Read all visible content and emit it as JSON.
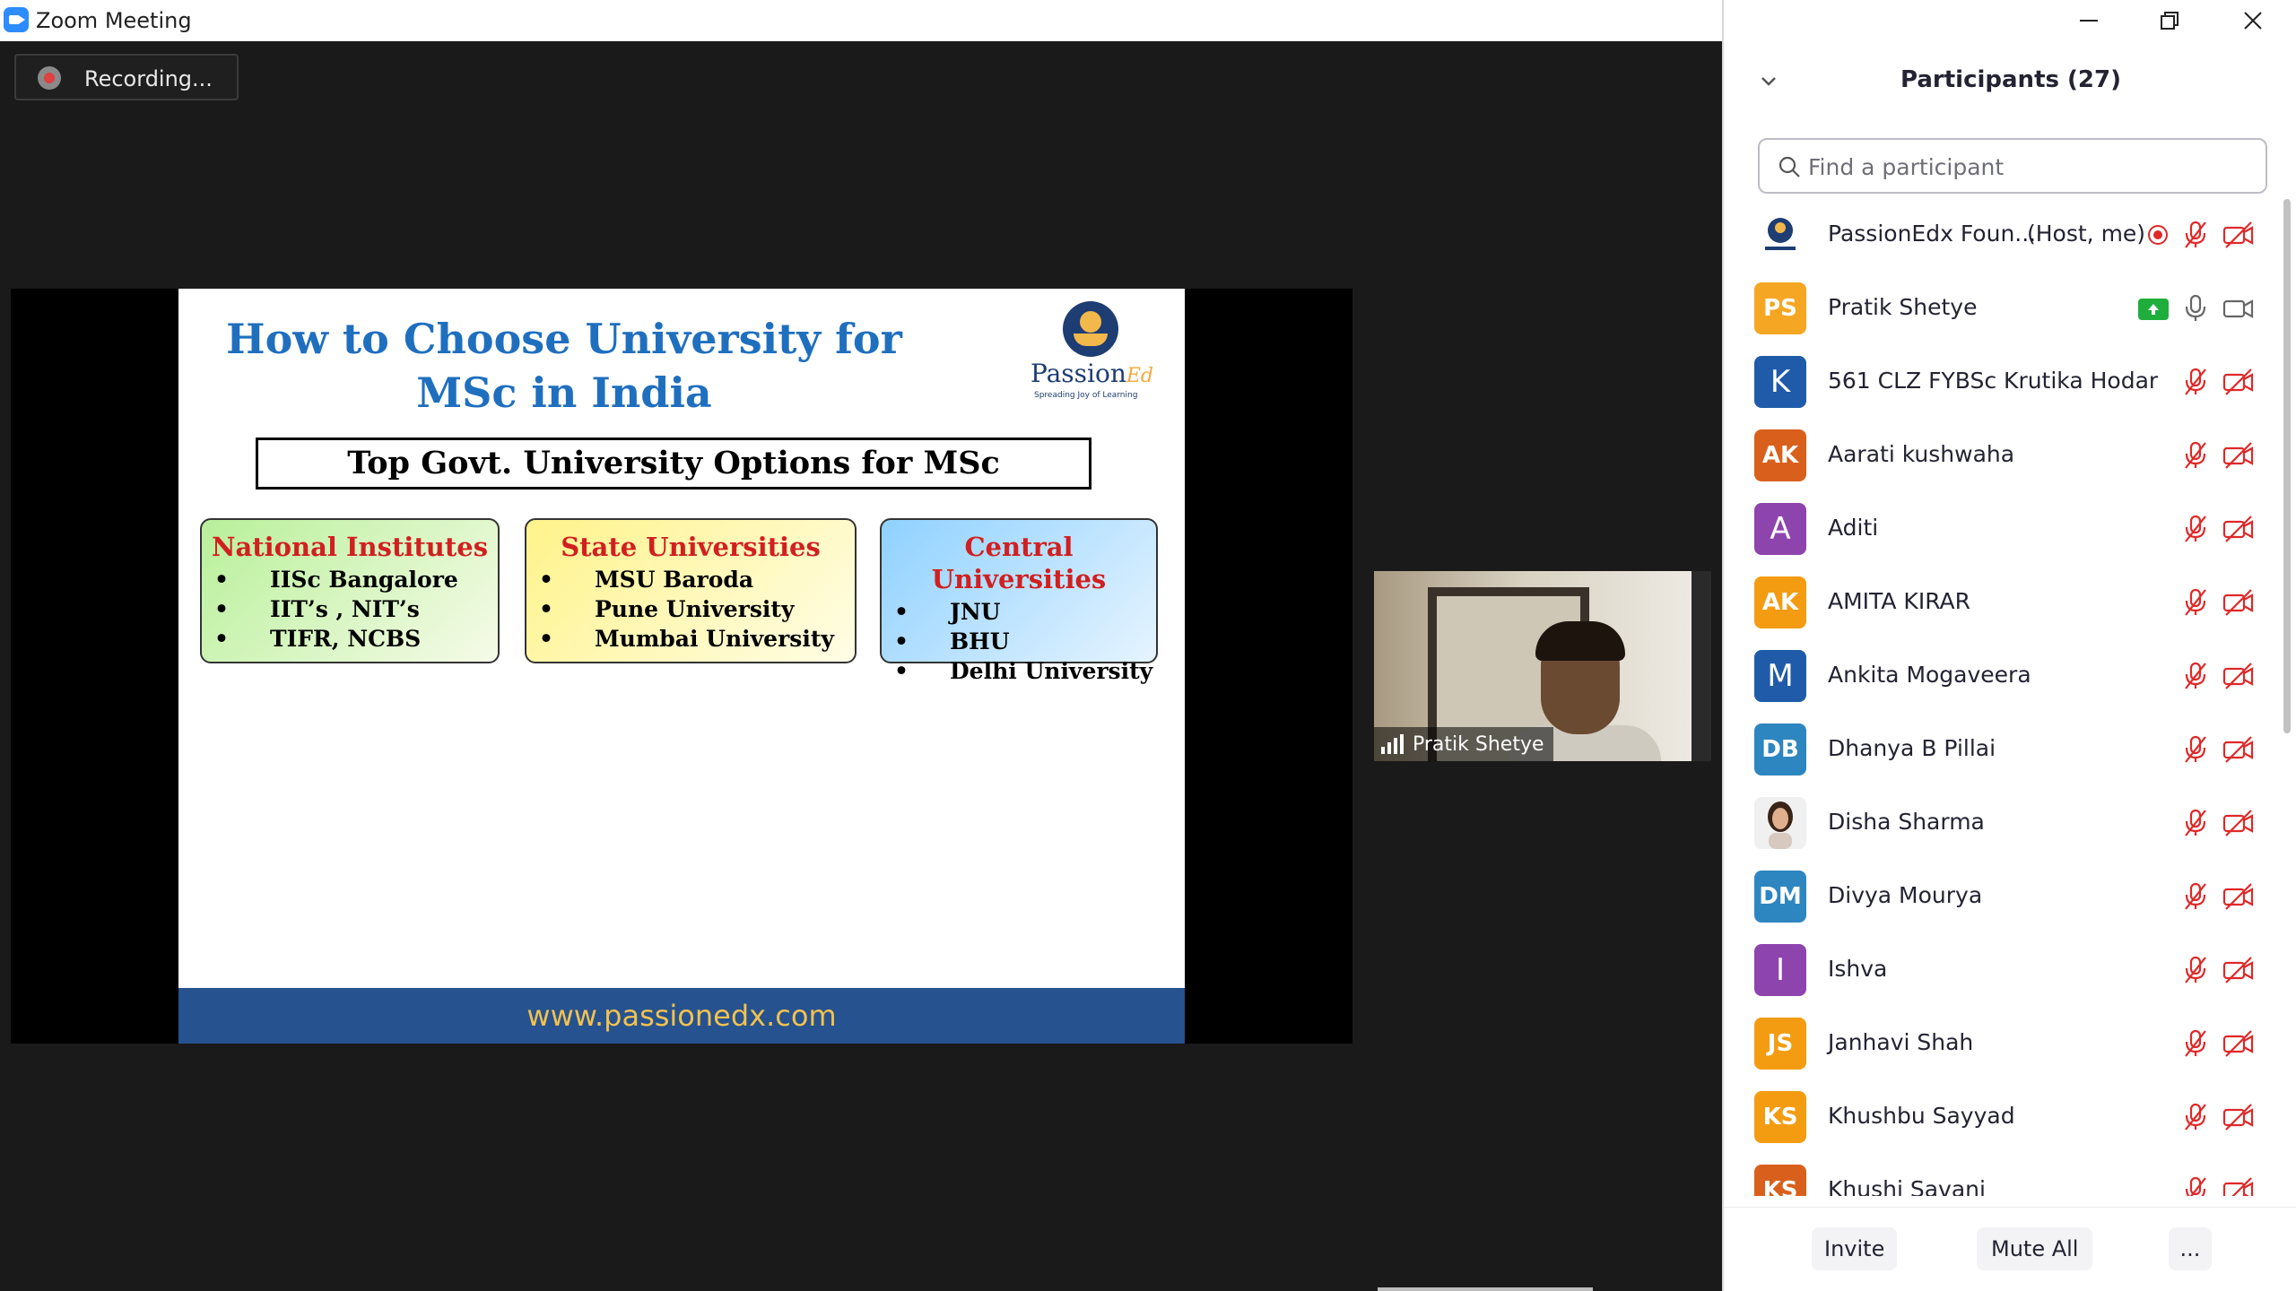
{
  "window": {
    "title": "Zoom Meeting",
    "app_icon": "zoom-video-icon"
  },
  "recording": {
    "label": "Recording..."
  },
  "slide": {
    "title": "How to Choose University for MSc in India",
    "brand": {
      "name": "Passion",
      "suffix": "Ed",
      "tagline": "Spreading Joy of Learning"
    },
    "subhead": "Top Govt. University Options for MSc",
    "boxes": [
      {
        "heading": "National Institutes",
        "items": [
          "IISc Bangalore",
          "IIT’s , NIT’s",
          "TIFR, NCBS"
        ]
      },
      {
        "heading": "State Universities",
        "items": [
          "MSU Baroda",
          "Pune University",
          "Mumbai University"
        ]
      },
      {
        "heading": "Central Universities",
        "items": [
          "JNU",
          "BHU",
          "Delhi University"
        ]
      }
    ],
    "footer": "www.passionedx.com"
  },
  "video": {
    "name": "Pratik Shetye"
  },
  "panel": {
    "title": "Participants (27)",
    "search_placeholder": "Find a participant",
    "participants": [
      {
        "name": "PassionEdx Foun...",
        "role": "(Host, me)",
        "avatar": "",
        "avatar_color": "#ffffff",
        "image": true
      },
      {
        "name": "Pratik Shetye",
        "avatar": "PS",
        "avatar_color": "#f5a623",
        "sharing": true
      },
      {
        "name": "561 CLZ FYBSc Krutika Hodar",
        "avatar": "K",
        "avatar_color": "#1f5ba8"
      },
      {
        "name": "Aarati kushwaha",
        "avatar": "AK",
        "avatar_color": "#d9601c"
      },
      {
        "name": "Aditi",
        "avatar": "A",
        "avatar_color": "#8e44ad"
      },
      {
        "name": "AMITA KIRAR",
        "avatar": "AK",
        "avatar_color": "#f39c12"
      },
      {
        "name": "Ankita Mogaveera",
        "avatar": "M",
        "avatar_color": "#1f5ba8"
      },
      {
        "name": "Dhanya B Pillai",
        "avatar": "DB",
        "avatar_color": "#2e86c1"
      },
      {
        "name": "Disha Sharma",
        "avatar": "",
        "avatar_color": "#f0f0f0",
        "image": true
      },
      {
        "name": "Divya Mourya",
        "avatar": "DM",
        "avatar_color": "#2e86c1"
      },
      {
        "name": "Ishva",
        "avatar": "I",
        "avatar_color": "#8e44ad"
      },
      {
        "name": "Janhavi Shah",
        "avatar": "JS",
        "avatar_color": "#f39c12"
      },
      {
        "name": "Khushbu Sayyad",
        "avatar": "KS",
        "avatar_color": "#f39c12"
      },
      {
        "name": "Khushi Savani",
        "avatar": "KS",
        "avatar_color": "#d9601c"
      }
    ],
    "buttons": {
      "invite": "Invite",
      "mute_all": "Mute All",
      "more": "..."
    }
  },
  "colors": {
    "accent": "#2d8cff",
    "muted_red": "#e02828",
    "slide_title": "#1f6fbf",
    "footer_bg": "#26528f",
    "footer_text": "#f2c14e"
  }
}
